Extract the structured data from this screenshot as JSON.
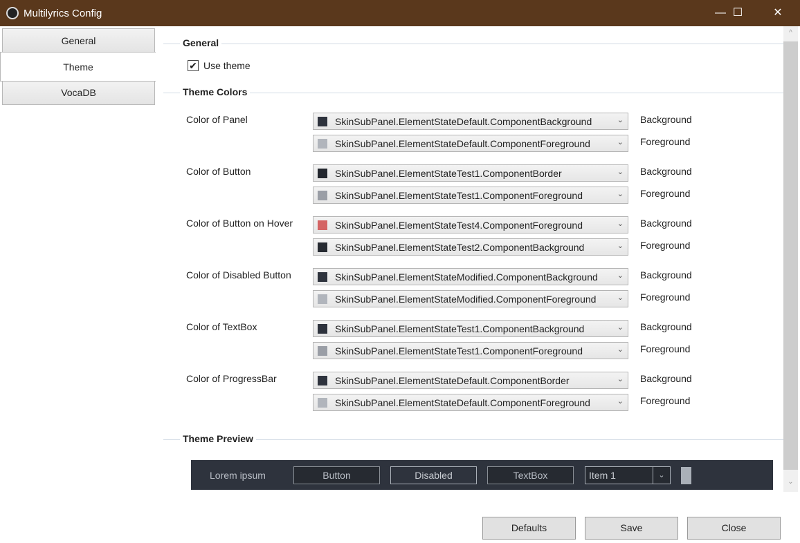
{
  "window": {
    "title": "Multilyrics Config",
    "minimize": "—",
    "maximize": "☐",
    "close": "✕"
  },
  "tabs": [
    {
      "label": "General"
    },
    {
      "label": "Theme",
      "selected": true
    },
    {
      "label": "VocaDB"
    }
  ],
  "general": {
    "heading": "General",
    "use_theme_label": "Use theme",
    "use_theme_checked": true,
    "check": "✔"
  },
  "theme_colors": {
    "heading": "Theme Colors",
    "bg_label": "Background",
    "fg_label": "Foreground",
    "chevron": "⌄",
    "groups": [
      {
        "label": "Color of Panel",
        "bg": {
          "value": "SkinSubPanel.ElementStateDefault.ComponentBackground",
          "color": "#2e333d"
        },
        "fg": {
          "value": "SkinSubPanel.ElementStateDefault.ComponentForeground",
          "color": "#b1b5bc"
        }
      },
      {
        "label": "Color of Button",
        "bg": {
          "value": "SkinSubPanel.ElementStateTest1.ComponentBorder",
          "color": "#23272e"
        },
        "fg": {
          "value": "SkinSubPanel.ElementStateTest1.ComponentForeground",
          "color": "#9a9ea6"
        }
      },
      {
        "label": "Color of Button on Hover",
        "bg": {
          "value": "SkinSubPanel.ElementStateTest4.ComponentForeground",
          "color": "#d46464"
        },
        "fg": {
          "value": "SkinSubPanel.ElementStateTest2.ComponentBackground",
          "color": "#262a31"
        }
      },
      {
        "label": "Color of Disabled Button",
        "bg": {
          "value": "SkinSubPanel.ElementStateModified.ComponentBackground",
          "color": "#2e333d"
        },
        "fg": {
          "value": "SkinSubPanel.ElementStateModified.ComponentForeground",
          "color": "#b1b5bc"
        }
      },
      {
        "label": "Color of TextBox",
        "bg": {
          "value": "SkinSubPanel.ElementStateTest1.ComponentBackground",
          "color": "#2e333d"
        },
        "fg": {
          "value": "SkinSubPanel.ElementStateTest1.ComponentForeground",
          "color": "#9a9ea6"
        }
      },
      {
        "label": "Color of ProgressBar",
        "bg": {
          "value": "SkinSubPanel.ElementStateDefault.ComponentBorder",
          "color": "#2e333d"
        },
        "fg": {
          "value": "SkinSubPanel.ElementStateDefault.ComponentForeground",
          "color": "#b1b5bc"
        }
      }
    ]
  },
  "preview": {
    "heading": "Theme Preview",
    "label": "Lorem ipsum",
    "button": "Button",
    "disabled": "Disabled",
    "textbox": "TextBox",
    "combo_value": "Item 1",
    "chevron": "⌄"
  },
  "footer": {
    "defaults": "Defaults",
    "save": "Save",
    "close": "Close"
  },
  "scrollbar": {
    "up": "^",
    "down": "⌄"
  }
}
